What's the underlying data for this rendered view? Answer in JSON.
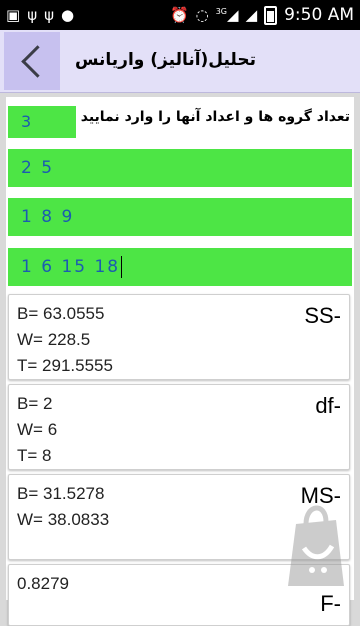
{
  "status_bar": {
    "network": "3G",
    "time": "9:50 AM"
  },
  "app_bar": {
    "title": "تحلیل(آنالیز) واریانس"
  },
  "input": {
    "prompt": "تعداد گروه ها و اعداد آنها را وارد نمایید",
    "group_count": "3",
    "groups": [
      "2 5",
      "1 8 9",
      "1 6 15 18"
    ]
  },
  "results": [
    {
      "label": "SS-",
      "lines": [
        "B= 63.0555",
        "W= 228.5",
        "T= 291.5555"
      ]
    },
    {
      "label": "df-",
      "lines": [
        "B= 2",
        "W= 6",
        "T= 8"
      ]
    },
    {
      "label": "MS-",
      "lines": [
        "B= 31.5278",
        "W= 38.0833"
      ]
    },
    {
      "label": "F-",
      "lines": [
        "0.8279"
      ]
    }
  ],
  "icons": {
    "back": "chevron-left-icon",
    "watermark": "shopping-bag-logo"
  },
  "colors": {
    "input_green": "#4de545",
    "input_text": "#1b5cb0",
    "app_bar": "#e3e0f8",
    "back_button": "#c7c1ef"
  }
}
